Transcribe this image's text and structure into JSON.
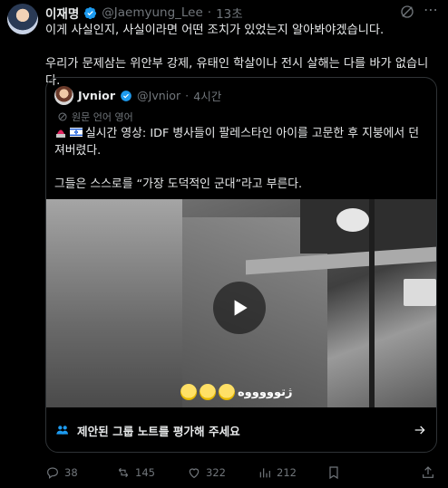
{
  "author": {
    "name": "이재명",
    "handle": "@Jaemyung_Lee",
    "separator": "·",
    "time": "13초"
  },
  "body": {
    "line1": "이게 사실인지, 사실이라면 어떤 조치가 있었는지 알아봐야겠습니다.",
    "line2": "우리가 문제삼는 위안부 강제, 유태인 학살이나 전시 살해는 다를 바가 없습니다."
  },
  "quote": {
    "name": "Jvnior",
    "handle": "@Jvnior",
    "separator": "·",
    "time": "4시간",
    "lang_note": "원문 언어 영어",
    "text1": "실시간 영상: IDF 병사들이 팔레스타인 아이를 고문한 후 지붕에서 던져버렸다.",
    "text2": "그들은 스스로를 “가장 도덕적인 군대”라고 부른다.",
    "video_overlay_text": "ژتوووووه"
  },
  "community_notes": {
    "label": "제안된 그룹 노트를 평가해 주세요"
  },
  "actions": {
    "replies": "38",
    "reposts": "145",
    "likes": "322",
    "views": "212"
  },
  "colors": {
    "background": "#000000",
    "text": "#e7e9ea",
    "muted": "#71767b",
    "verified": "#1d9bf0",
    "border": "#2f3336"
  }
}
